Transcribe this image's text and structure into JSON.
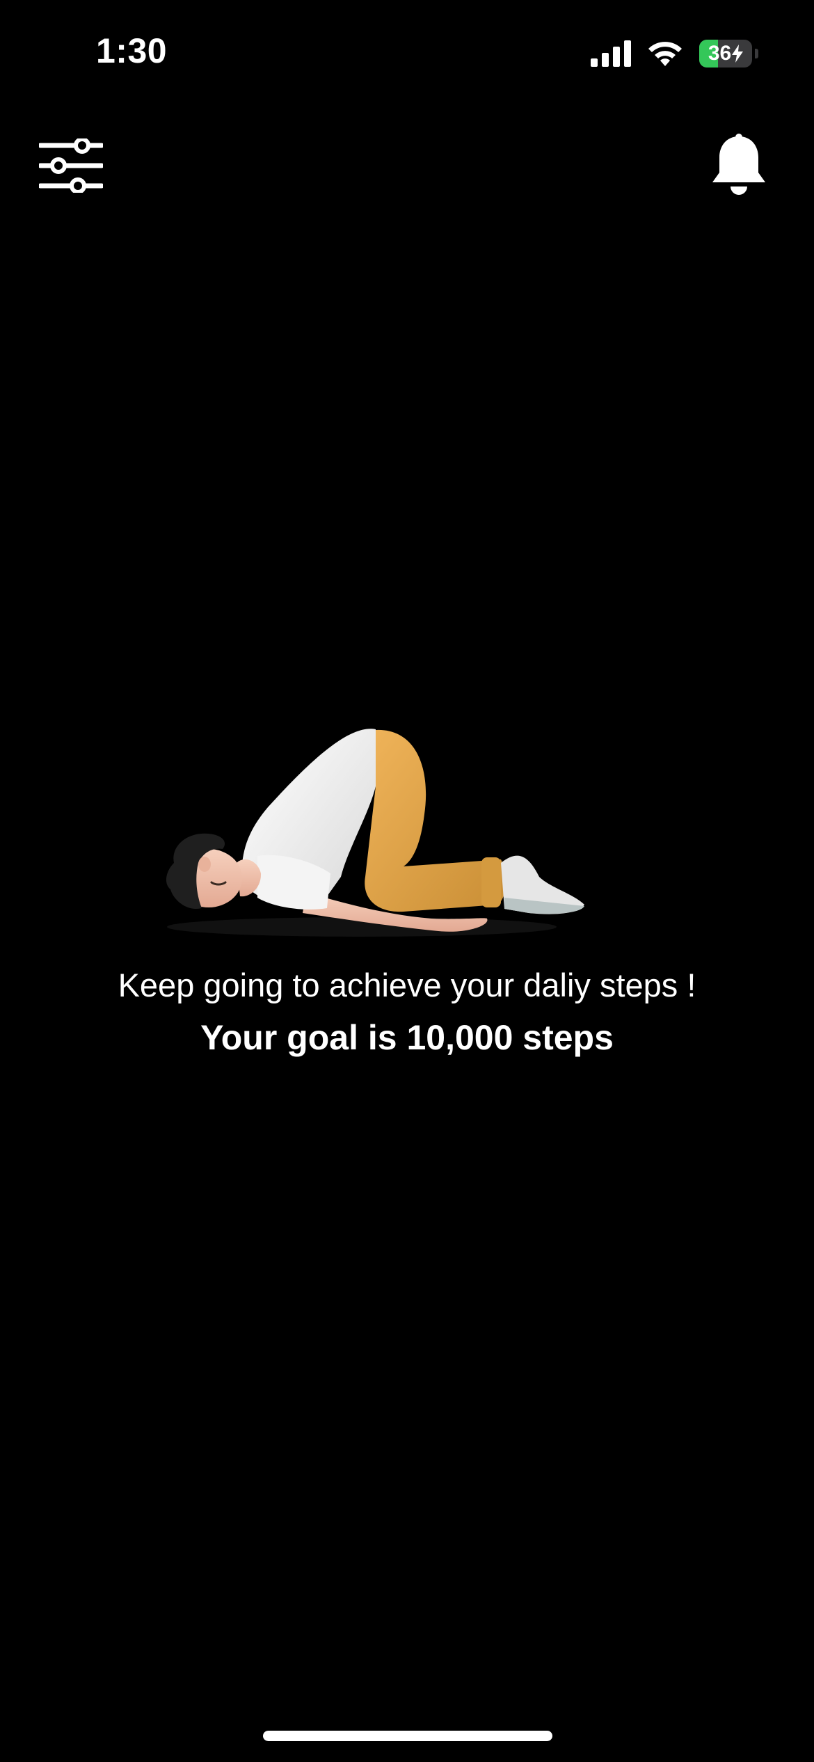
{
  "status_bar": {
    "time": "1:30",
    "battery_level": "36",
    "battery_fraction": 0.36,
    "battery_color": "#34c759"
  },
  "header": {
    "filter_icon": "sliders-icon",
    "notification_icon": "bell-icon"
  },
  "illustration": {
    "icon": "person-stretching-illustration"
  },
  "message": {
    "line1": "Keep going to achieve your daliy steps !",
    "line2": "Your goal is 10,000 steps"
  },
  "colors": {
    "background": "#000000",
    "text": "#ffffff"
  }
}
